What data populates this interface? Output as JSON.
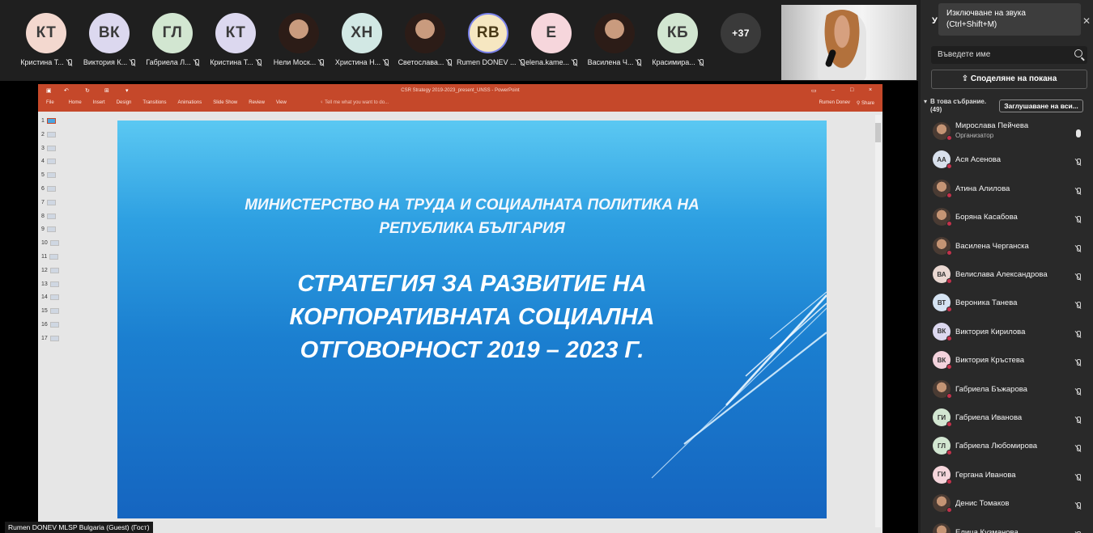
{
  "strip": {
    "tiles": [
      {
        "initials": "КТ",
        "name": "Кристина Т...",
        "color": "#f3d8cf"
      },
      {
        "initials": "ВК",
        "name": "Виктория К...",
        "color": "#dcd8ef"
      },
      {
        "initials": "ГЛ",
        "name": "Габриела Л...",
        "color": "#d2e6d1"
      },
      {
        "initials": "КТ",
        "name": "Кристина Т...",
        "color": "#dcd8ef"
      },
      {
        "initials": "",
        "name": "Нели Моск...",
        "color": "#2a2a2a"
      },
      {
        "initials": "ХН",
        "name": "Христина Н...",
        "color": "#d2e8e4"
      },
      {
        "initials": "",
        "name": "Светослава...",
        "color": "#2a2a2a"
      },
      {
        "initials": "RB",
        "name": "Rumen DONEV ...",
        "color": "#f6e7c1"
      },
      {
        "initials": "Е",
        "name": "elena.kame...",
        "color": "#f6d6dc"
      },
      {
        "initials": "",
        "name": "Василена Ч...",
        "color": "#2a2a2a"
      },
      {
        "initials": "КБ",
        "name": "Красимира...",
        "color": "#d2e6d1"
      }
    ],
    "overflow": "+37"
  },
  "ppt": {
    "doc_title": "CSR Strategy 2019-2023_present_UNSS - PowerPoint",
    "menus": [
      "File",
      "Home",
      "Insert",
      "Design",
      "Transitions",
      "Animations",
      "Slide Show",
      "Review",
      "View"
    ],
    "tell_me": "Tell me what you want to do...",
    "user": "Rumen Donev",
    "share": "Share",
    "slide_numbers": [
      "1",
      "2",
      "3",
      "4",
      "5",
      "6",
      "7",
      "8",
      "9",
      "10",
      "11",
      "12",
      "13",
      "14",
      "15",
      "16",
      "17"
    ]
  },
  "slide": {
    "ministry_line1": "МИНИСТЕРСТВО НА ТРУДА И СОЦИАЛНАТА ПОЛИТИКА НА",
    "ministry_line2": "РЕПУБЛИКА БЪЛГАРИЯ",
    "title_line1": "СТРАТЕГИЯ ЗА РАЗВИТИЕ НА",
    "title_line2": "КОРПОРАТИВНАТА СОЦИАЛНА",
    "title_line3": "ОТГОВОРНОСТ 2019 – 2023 Г."
  },
  "tooltip": {
    "line1": "Изключване на звука",
    "line2": "(Ctrl+Shift+M)"
  },
  "panel": {
    "title": "У",
    "search_placeholder": "Въведете име",
    "invite_label": "Споделяне на покана",
    "section_label": "В това събрание.",
    "section_count": "(49)",
    "mute_all": "Заглушаване на вси...",
    "participants": [
      {
        "initials": "",
        "name": "Мирослава Пейчева",
        "role": "Организатор",
        "color": "photo",
        "mic": "on"
      },
      {
        "initials": "АА",
        "name": "Ася Асенова",
        "color": "#d8e0ec",
        "mic": "off"
      },
      {
        "initials": "",
        "name": "Атина Алилова",
        "color": "photo",
        "mic": "off"
      },
      {
        "initials": "",
        "name": "Боряна Касабова",
        "color": "photo",
        "mic": "off"
      },
      {
        "initials": "",
        "name": "Василена Черганска",
        "color": "photo",
        "mic": "off"
      },
      {
        "initials": "ВА",
        "name": "Велислава Александрова",
        "color": "#ead8d2",
        "mic": "off"
      },
      {
        "initials": "ВТ",
        "name": "Вероника Танева",
        "color": "#d5e3f2",
        "mic": "off"
      },
      {
        "initials": "ВК",
        "name": "Виктория Кирилова",
        "color": "#dcd8ef",
        "mic": "off"
      },
      {
        "initials": "ВК",
        "name": "Виктория Кръстева",
        "color": "#f3d2dc",
        "mic": "off"
      },
      {
        "initials": "",
        "name": "Габриела Бъжарова",
        "color": "photo",
        "mic": "off"
      },
      {
        "initials": "ГИ",
        "name": "Габриела Иванова",
        "color": "#d2e6d1",
        "mic": "off"
      },
      {
        "initials": "ГЛ",
        "name": "Габриела Любомирова",
        "color": "#d2e6d1",
        "mic": "off"
      },
      {
        "initials": "ГИ",
        "name": "Гергана Иванова",
        "color": "#f6d6dc",
        "mic": "off"
      },
      {
        "initials": "",
        "name": "Денис Томаков",
        "color": "photo",
        "mic": "off"
      },
      {
        "initials": "",
        "name": "Елица Кузманова",
        "color": "photo",
        "mic": "off"
      }
    ]
  },
  "bottom_label": "Rumen DONEV MLSP Bulgaria (Guest) (Гост)"
}
